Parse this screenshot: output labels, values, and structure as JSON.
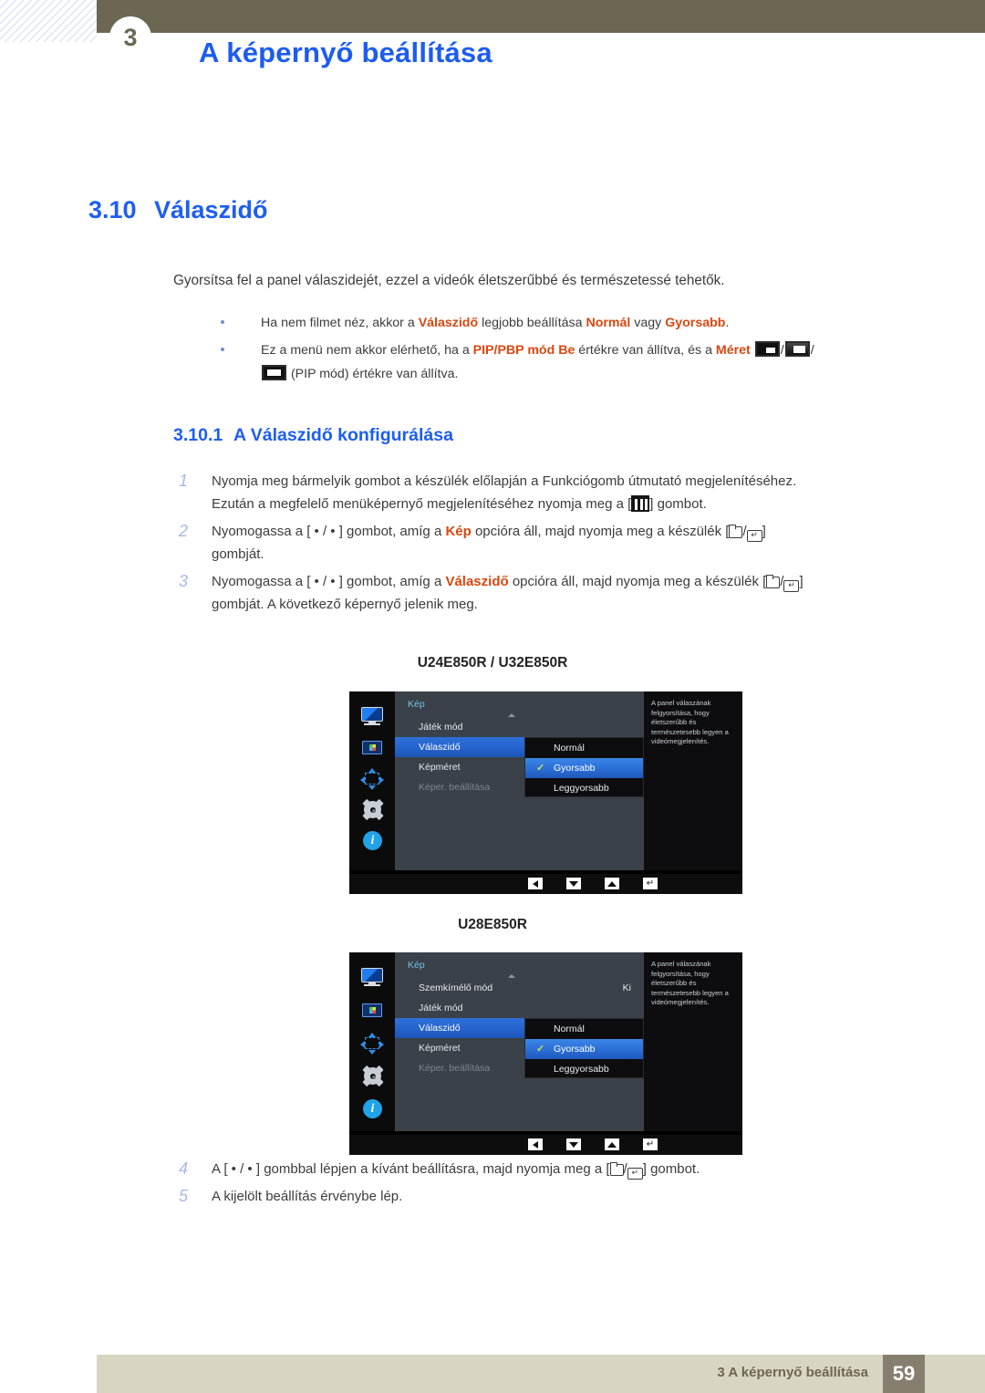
{
  "header": {
    "chapter_number": "3",
    "title": "A képernyő beállítása"
  },
  "section": {
    "number": "3.10",
    "title": "Válaszidő",
    "intro": "Gyorsítsa fel a panel válaszidejét, ezzel a videók életszerűbbé és természetessé tehetők.",
    "bullets": [
      {
        "part1": "Ha nem filmet néz, akkor a ",
        "bold1": "Válaszidő",
        "part2": " legjobb beállítása ",
        "bold2": "Normál",
        "part3": " vagy ",
        "bold3": "Gyorsabb",
        "part4": "."
      },
      {
        "part1": "Ez a menü nem akkor elérhető, ha a ",
        "bold1": "PIP/PBP mód Be",
        "part2": " értékre van állítva, és a ",
        "bold2": "Méret",
        "part3": " (PIP mód) értékre van állítva.",
        "icon1": "pip-size-small-icon",
        "icon2": "pip-size-medium-icon",
        "icon3": "pip-size-large-icon"
      }
    ]
  },
  "subsection": {
    "number": "3.10.1",
    "title": "A Válaszidő konfigurálása",
    "steps_first": [
      {
        "n": "1",
        "line1": "Nyomja meg bármelyik gombot a készülék előlapján a Funkciógomb útmutató megjelenítéséhez.",
        "line2a": "Ezután a megfelelő menüképernyő megjelenítéséhez nyomja meg a [",
        "icon": "menu-button-icon",
        "line2b": "] gombot."
      },
      {
        "n": "2",
        "a": "Nyomogassa a [ • / • ] gombot, amíg a ",
        "bold": "Kép",
        "b": " opcióra áll, majd nyomja meg a készülék [",
        "icon1": "source-button-icon",
        "sep": "/",
        "icon2": "enter-button-icon",
        "c": "]",
        "line2": "gombját."
      },
      {
        "n": "3",
        "a": "Nyomogassa a [ • / • ] gombot, amíg a ",
        "bold": "Válaszidő",
        "b": " opcióra áll, majd nyomja meg a készülék [",
        "icon1": "source-button-icon",
        "sep": "/",
        "icon2": "enter-button-icon",
        "c": "]",
        "line2": "gombját. A következő képernyő jelenik meg."
      }
    ],
    "steps_last": [
      {
        "n": "4",
        "a": "A [ • / • ] gombbal lépjen a kívánt beállításra, majd nyomja meg a [",
        "icon1": "source-button-icon",
        "sep": "/",
        "icon2": "enter-button-icon",
        "c": "] gombot."
      },
      {
        "n": "5",
        "a": "A kijelölt beállítás érvénybe lép."
      }
    ]
  },
  "figures": [
    {
      "label": "U24E850R / U32E850R",
      "menu_title": "Kép",
      "rail_icons": [
        "monitor-icon",
        "picture-icon",
        "pip-icon",
        "gear-icon",
        "info-icon"
      ],
      "rows": [
        {
          "label": "Játék mód",
          "value": "",
          "state": "normal"
        },
        {
          "label": "Válaszidő",
          "value": "",
          "state": "selected"
        },
        {
          "label": "Képméret",
          "value": "",
          "state": "normal"
        },
        {
          "label": "Képer. beállítása",
          "value": "",
          "state": "disabled"
        }
      ],
      "submenu": [
        {
          "label": "Normál",
          "checked": false
        },
        {
          "label": "Gyorsabb",
          "checked": true
        },
        {
          "label": "Leggyorsabb",
          "checked": false
        }
      ],
      "description": "A panel válaszának felgyorsítása, hogy életszerűbb és természetesebb legyen a videómegjelenítés.",
      "footer_buttons": [
        "left-arrow-button",
        "down-arrow-button",
        "up-arrow-button",
        "enter-button"
      ]
    },
    {
      "label": "U28E850R",
      "menu_title": "Kép",
      "rail_icons": [
        "monitor-icon",
        "picture-icon",
        "pip-icon",
        "gear-icon",
        "info-icon"
      ],
      "rows": [
        {
          "label": "Szemkímélő mód",
          "value": "Ki",
          "state": "normal"
        },
        {
          "label": "Játék mód",
          "value": "",
          "state": "normal"
        },
        {
          "label": "Válaszidő",
          "value": "",
          "state": "selected"
        },
        {
          "label": "Képméret",
          "value": "",
          "state": "normal"
        },
        {
          "label": "Képer. beállítása",
          "value": "",
          "state": "disabled"
        }
      ],
      "submenu": [
        {
          "label": "Normál",
          "checked": false
        },
        {
          "label": "Gyorsabb",
          "checked": true
        },
        {
          "label": "Leggyorsabb",
          "checked": false
        }
      ],
      "description": "A panel válaszának felgyorsítása, hogy életszerűbb és természetesebb legyen a videómegjelenítés.",
      "footer_buttons": [
        "left-arrow-button",
        "down-arrow-button",
        "up-arrow-button",
        "enter-button"
      ]
    }
  ],
  "footer": {
    "text": "3 A képernyő beállítása",
    "page": "59"
  },
  "colors": {
    "header_bar": "#6b6752",
    "heading_blue": "#1d5ef0",
    "accent_red": "#d9470f",
    "footer_bar": "#d9d5c3",
    "page_box": "#867f6f",
    "osd_selected": "#2565cf",
    "osd_check": "#c8e04b"
  }
}
